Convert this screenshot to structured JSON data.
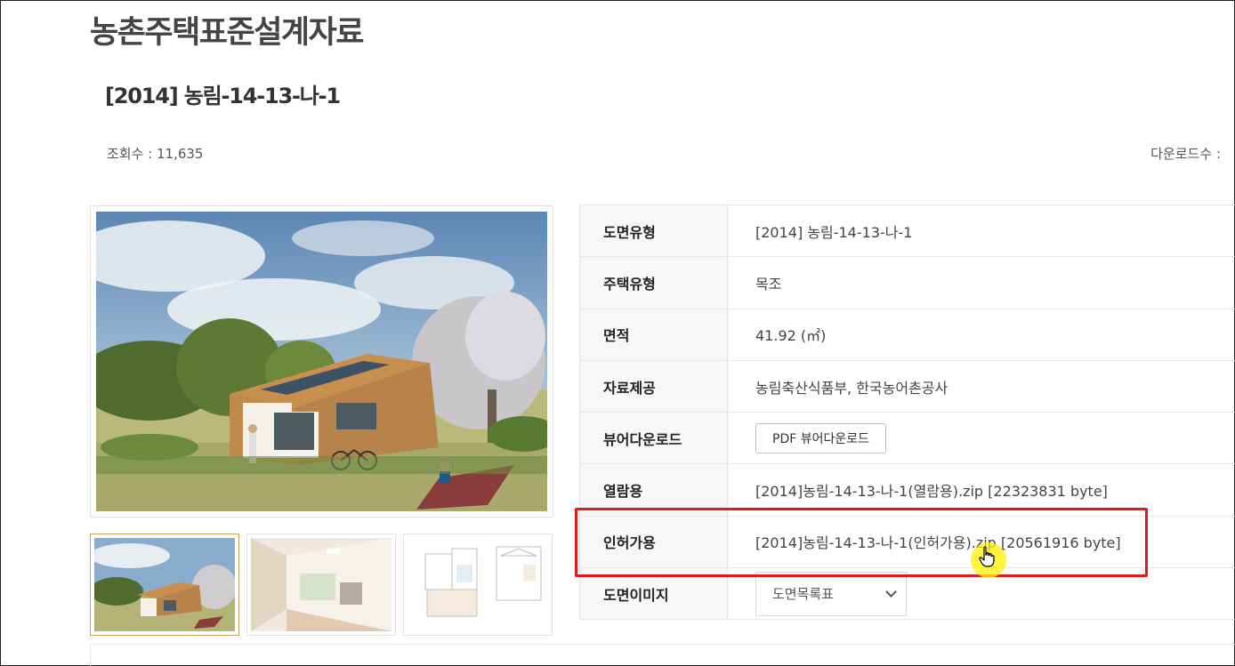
{
  "page": {
    "title": "농촌주택표준설계자료",
    "item_title": "[2014] 농림-14-13-나-1",
    "views_text": "조회수 : 11,635",
    "downloads_text": "다운로드수 :"
  },
  "gallery": {
    "thumbs": [
      "thumb-exterior",
      "thumb-interior",
      "thumb-floorplan"
    ]
  },
  "info": {
    "rows": [
      {
        "label": "도면유형",
        "value": "[2014] 농림-14-13-나-1"
      },
      {
        "label": "주택유형",
        "value": "목조"
      },
      {
        "label": "면적",
        "value": "41.92 (㎡)"
      },
      {
        "label": "자료제공",
        "value": "농림축산식품부, 한국농어촌공사"
      },
      {
        "label": "뷰어다운로드",
        "button": "PDF 뷰어다운로드"
      },
      {
        "label": "열람용",
        "value": "[2014]농림-14-13-나-1(열람용).zip [22323831 byte]"
      },
      {
        "label": "인허가용",
        "value": "[2014]농림-14-13-나-1(인허가용).zip [20561916 byte]"
      },
      {
        "label": "도면이미지",
        "select": "도면목록표"
      }
    ]
  },
  "colors": {
    "highlight": "#e01b1b",
    "cursor_glow": "#fff000",
    "active_thumb_border": "#c9a15a"
  },
  "icons": {
    "cursor": "hand-pointer-icon",
    "select": "chevron-down-icon"
  }
}
